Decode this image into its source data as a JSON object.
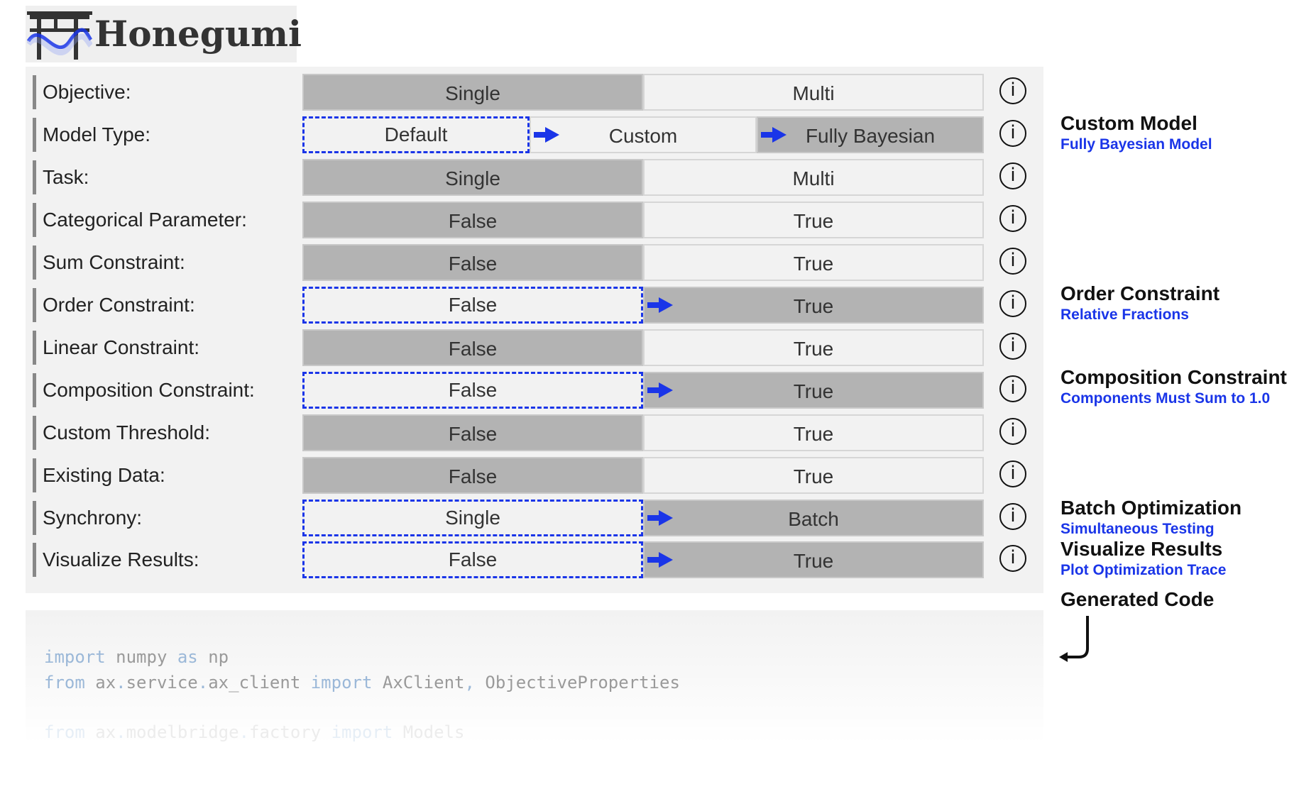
{
  "brand": {
    "name": "Honegumi"
  },
  "rows": [
    {
      "label": "Objective:",
      "options": [
        "Single",
        "Multi"
      ]
    },
    {
      "label": "Model Type:",
      "options": [
        "Default",
        "Custom",
        "Fully Bayesian"
      ]
    },
    {
      "label": "Task:",
      "options": [
        "Single",
        "Multi"
      ]
    },
    {
      "label": "Categorical Parameter:",
      "options": [
        "False",
        "True"
      ]
    },
    {
      "label": "Sum Constraint:",
      "options": [
        "False",
        "True"
      ]
    },
    {
      "label": "Order Constraint:",
      "options": [
        "False",
        "True"
      ]
    },
    {
      "label": "Linear Constraint:",
      "options": [
        "False",
        "True"
      ]
    },
    {
      "label": "Composition Constraint:",
      "options": [
        "False",
        "True"
      ]
    },
    {
      "label": "Custom Threshold:",
      "options": [
        "False",
        "True"
      ]
    },
    {
      "label": "Existing Data:",
      "options": [
        "False",
        "True"
      ]
    },
    {
      "label": "Synchrony:",
      "options": [
        "Single",
        "Batch"
      ]
    },
    {
      "label": "Visualize Results:",
      "options": [
        "False",
        "True"
      ]
    }
  ],
  "info_glyph": "i",
  "annotations": [
    {
      "title": "Custom Model",
      "subtitle": "Fully Bayesian Model"
    },
    {
      "title": "Order Constraint",
      "subtitle": "Relative Fractions"
    },
    {
      "title": "Composition Constraint",
      "subtitle": "Components Must Sum to 1.0"
    },
    {
      "title": "Batch Optimization",
      "subtitle": "Simultaneous Testing"
    },
    {
      "title": "Visualize Results",
      "subtitle": "Plot Optimization Trace"
    },
    {
      "title": "Generated Code"
    }
  ],
  "code": {
    "line1": {
      "k1": "import",
      "t1": " numpy ",
      "k2": "as",
      "t2": " np"
    },
    "line2": {
      "k1": "from",
      "t1": " ax",
      "k2": ".",
      "t2": "service",
      "k3": ".",
      "t3": "ax_client ",
      "k4": "import",
      "t4": " AxClient",
      "k5": ",",
      "t5": " ObjectiveProperties"
    },
    "line3": {
      "k1": "from",
      "t1": " ax",
      "k2": ".",
      "t2": "modelbridge",
      "k3": ".",
      "t3": "factory ",
      "k4": "import",
      "t4": " Models"
    }
  },
  "colors": {
    "accent": "#1a35e8",
    "selected_fill": "#b3b3b3",
    "panel": "#f2f2f2"
  }
}
